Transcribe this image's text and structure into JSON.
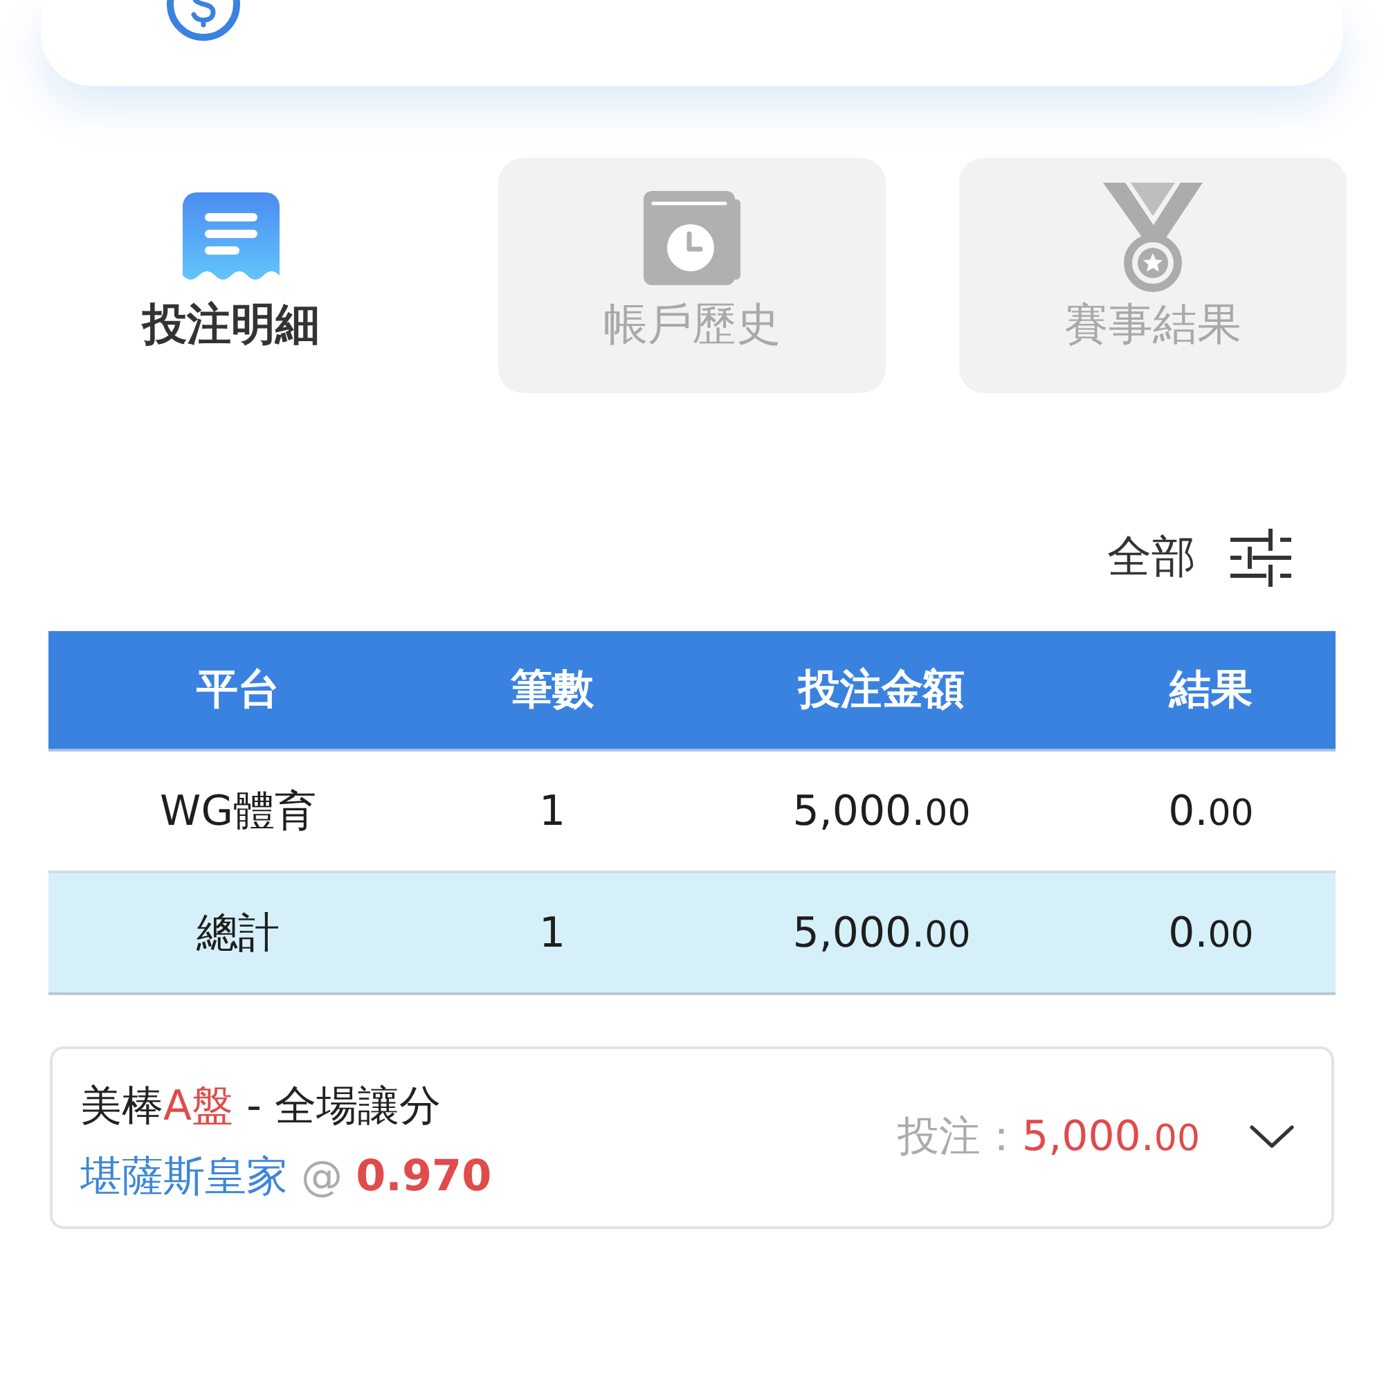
{
  "tabs": [
    {
      "label": "投注明細",
      "selected": true
    },
    {
      "label": "帳戶歷史",
      "selected": false
    },
    {
      "label": "賽事結果",
      "selected": false
    }
  ],
  "filter": {
    "label": "全部"
  },
  "table": {
    "columns": [
      "平台",
      "筆數",
      "投注金額",
      "結果"
    ],
    "rows": [
      {
        "kind": "data",
        "cells": [
          "WG體育",
          "1",
          "5,000.00",
          "0.00"
        ]
      },
      {
        "kind": "total",
        "cells": [
          "總計",
          "1",
          "5,000.00",
          "0.00"
        ]
      }
    ]
  },
  "bet": {
    "league": "美棒",
    "handicap": "A盤",
    "separator": "-",
    "market": "全場讓分",
    "selection": "堪薩斯皇家",
    "at": "@",
    "odds": "0.970",
    "stake_label": "投注：",
    "stake": "5,000.00",
    "expanded": false
  }
}
